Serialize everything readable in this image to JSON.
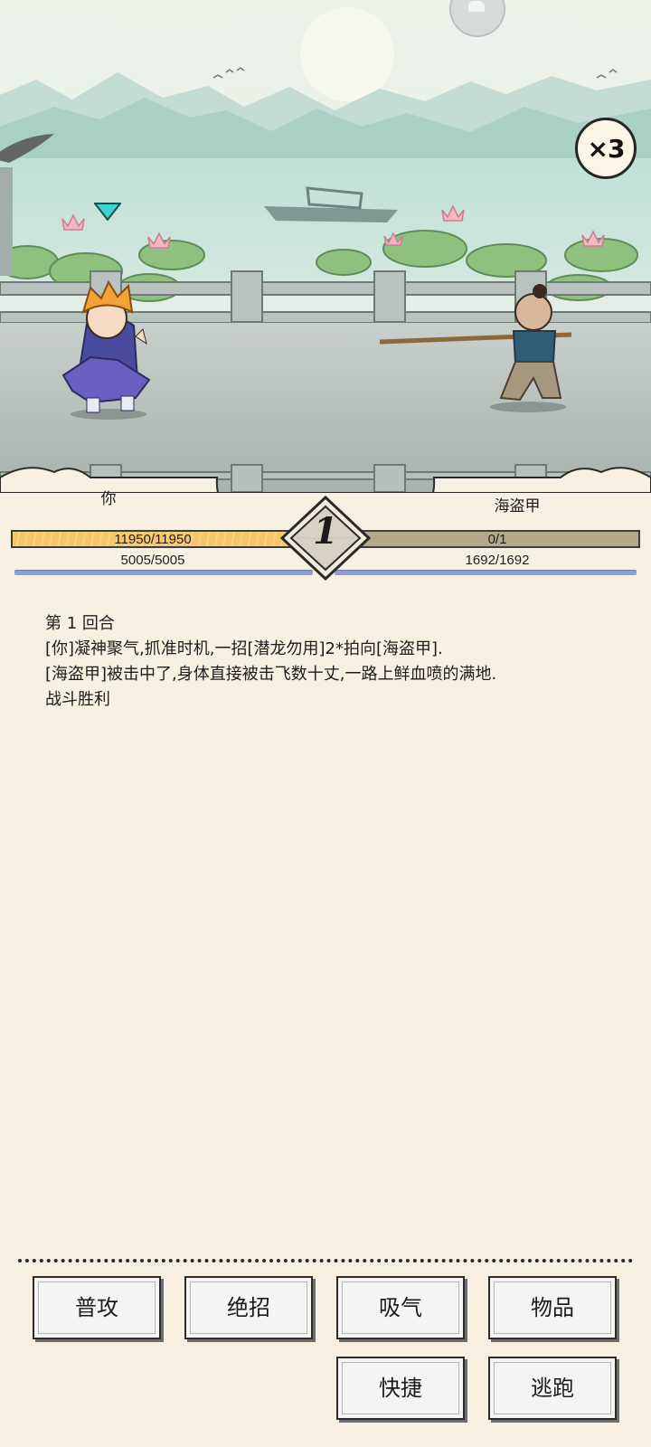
{
  "battle": {
    "speed_multiplier": "×3",
    "round_number": "1"
  },
  "player": {
    "name": "你",
    "hp": "11950/11950",
    "mp": "5005/5005",
    "hp_fill_fraction": 1.0
  },
  "enemy": {
    "name": "海盗甲",
    "hp": "0/1",
    "mp": "1692/1692",
    "hp_fill_fraction": 0.0
  },
  "log": {
    "lines": [
      "第 1 回合",
      "[你]凝神聚气,抓准时机,一招[潜龙勿用]2*拍向[海盗甲].",
      "[海盗甲]被击中了,身体直接被击飞数十丈,一路上鲜血喷的满地.",
      "战斗胜利"
    ]
  },
  "actions": {
    "attack": "普攻",
    "ultimate": "绝招",
    "absorb_qi": "吸气",
    "items": "物品",
    "shortcut": "快捷",
    "flee": "逃跑"
  },
  "colors": {
    "background": "#f8f1e1",
    "hp_player": "#f6c668",
    "hp_enemy": "#b3a98a",
    "mp_line": "#8f9ed0",
    "target_marker": "#3fd2cf"
  }
}
